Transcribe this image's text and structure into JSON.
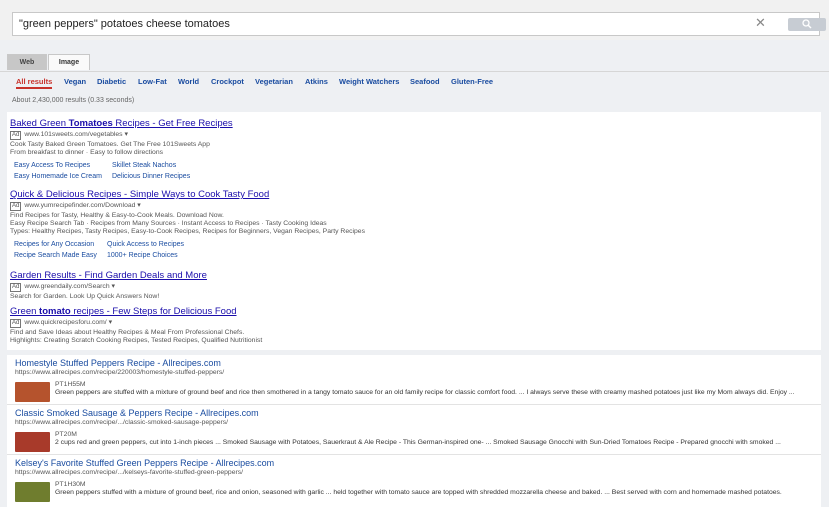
{
  "search": {
    "query": "\"green peppers\" potatoes cheese tomatoes"
  },
  "tabs": [
    "Web",
    "Image"
  ],
  "filters": [
    "All results",
    "Vegan",
    "Diabetic",
    "Low-Fat",
    "World",
    "Crockpot",
    "Vegetarian",
    "Atkins",
    "Weight Watchers",
    "Seafood",
    "Gluten-Free"
  ],
  "results_count": "About 2,430,000 results (0.33 seconds)",
  "ad_badge": "Ad",
  "ads": [
    {
      "title_pre": "Baked Green ",
      "title_bold": "Tomatoes",
      "title_post": " Recipes - Get Free Recipes",
      "url": "www.101sweets.com/vegetables",
      "lines": [
        "Cook Tasty Baked Green Tomatoes. Get The Free 101Sweets App",
        "From breakfast to dinner · Easy to follow directions"
      ],
      "sitelinks": [
        "Easy Access To Recipes",
        "Skillet Steak Nachos",
        "Easy Homemade Ice Cream",
        "Delicious Dinner Recipes"
      ]
    },
    {
      "title": "Quick & Delicious Recipes - Simple Ways to Cook Tasty Food",
      "url": "www.yumrecipefinder.com/Download",
      "lines": [
        "Find Recipes for Tasty, Healthy & Easy-to-Cook Meals. Download Now.",
        "Easy Recipe Search Tab · Recipes from Many Sources · Instant Access to Recipes · Tasty Cooking Ideas",
        "Types: Healthy Recipes, Tasty Recipes, Easy-to-Cook Recipes, Recipes for Beginners, Vegan Recipes, Party Recipes"
      ],
      "sitelinks": [
        "Recipes for Any Occasion",
        "Quick Access to Recipes",
        "Recipe Search Made Easy",
        "1000+ Recipe Choices"
      ]
    },
    {
      "title": "Garden Results - Find Garden Deals and More",
      "url": "www.greendaily.com/Search",
      "lines": [
        "Search for Garden. Look Up Quick Answers Now!"
      ]
    },
    {
      "title_pre": "Green ",
      "title_bold": "tomato",
      "title_post": " recipes - Few Steps for Delicious Food",
      "url": "www.quickrecipesforu.com/",
      "lines": [
        "Find and Save Ideas about Healthy Recipes & Meal From Professional Chefs.",
        "Highlights: Creating Scratch Cooking Recipes, Tested Recipes, Qualified Nutritionist"
      ]
    }
  ],
  "organic": [
    {
      "title": "Homestyle Stuffed Peppers Recipe - Allrecipes.com",
      "url": "https://www.allrecipes.com/recipe/220003/homestyle-stuffed-peppers/",
      "duration": "PT1H55M",
      "snippet": "Green peppers are stuffed with a mixture of ground beef and rice then smothered in a tangy tomato sauce for an old family recipe for classic comfort food. ... I always serve these with creamy mashed potatoes just like my Mom always did. Enjoy ...",
      "thumb_color": "#b5532d"
    },
    {
      "title": "Classic Smoked Sausage & Peppers Recipe - Allrecipes.com",
      "url": "https://www.allrecipes.com/recipe/.../classic-smoked-sausage-peppers/",
      "duration": "PT20M",
      "snippet": "2 cups red and green peppers, cut into 1-inch pieces ... Smoked Sausage with Potatoes, Sauerkraut & Ale Recipe - This German-inspired one- ... Smoked Sausage Gnocchi with Sun-Dried Tomatoes Recipe - Prepared gnocchi with smoked ...",
      "thumb_color": "#a83a2a"
    },
    {
      "title": "Kelsey's Favorite Stuffed Green Peppers Recipe - Allrecipes.com",
      "url": "https://www.allrecipes.com/recipe/.../kelseys-favorite-stuffed-green-peppers/",
      "duration": "PT1H30M",
      "snippet": "Green peppers stuffed with a mixture of ground beef, rice and onion, seasoned with garlic ... held together with tomato sauce are topped with shredded mozzarella cheese and baked. ... Best served with corn and homemade mashed potatoes.",
      "thumb_color": "#6f7d2e"
    }
  ]
}
